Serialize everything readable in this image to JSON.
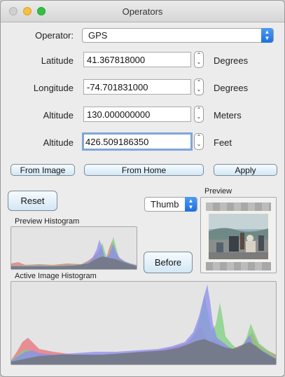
{
  "window": {
    "title": "Operators"
  },
  "operator": {
    "label": "Operator:",
    "value": "GPS"
  },
  "fields": [
    {
      "label": "Latitude",
      "value": "41.367818000",
      "unit": "Degrees"
    },
    {
      "label": "Longitude",
      "value": "-74.701831000",
      "unit": "Degrees"
    },
    {
      "label": "Altitude",
      "value": "130.000000000",
      "unit": "Meters"
    },
    {
      "label": "Altitude",
      "value": "426.509186350",
      "unit": "Feet"
    }
  ],
  "buttons": {
    "from_image": "From Image",
    "from_home": "From Home",
    "apply": "Apply",
    "reset": "Reset",
    "before": "Before"
  },
  "preview": {
    "label": "Preview",
    "mode": "Thumb"
  },
  "histograms": {
    "preview_label": "Preview Histogram",
    "active_label": "Active Image Histogram"
  },
  "colors": {
    "histogram_red": "#e8707a",
    "histogram_green": "#7fd07f",
    "histogram_blue": "#8c8cf0",
    "histogram_gray": "#6f7378",
    "accent_blue": "#1f6fe0"
  }
}
